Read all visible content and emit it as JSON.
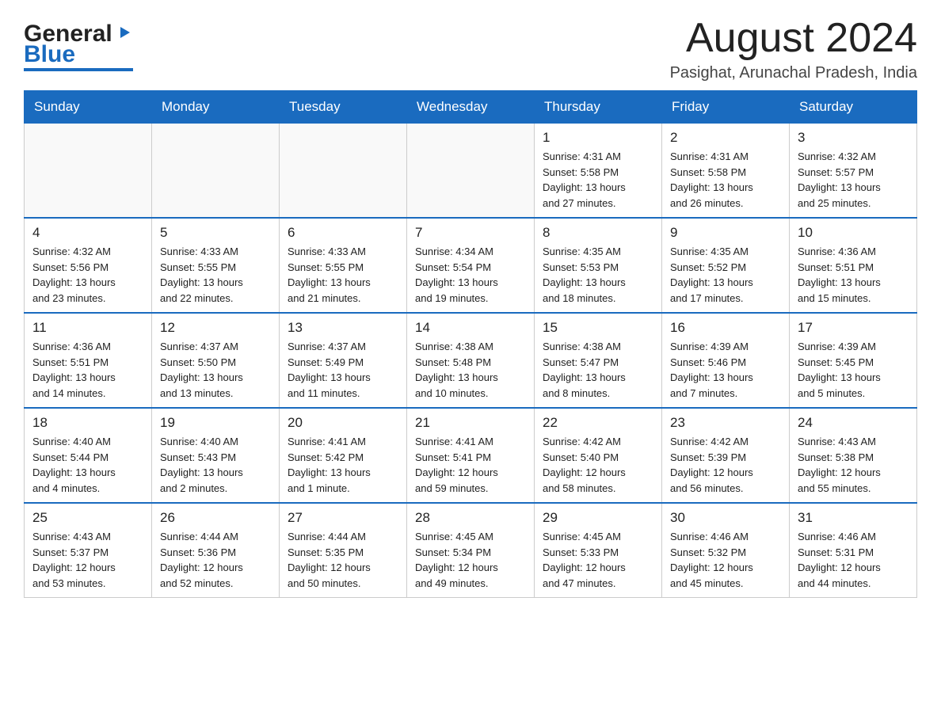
{
  "header": {
    "logo_general": "General",
    "logo_blue": "Blue",
    "main_title": "August 2024",
    "subtitle": "Pasighat, Arunachal Pradesh, India"
  },
  "days_of_week": [
    "Sunday",
    "Monday",
    "Tuesday",
    "Wednesday",
    "Thursday",
    "Friday",
    "Saturday"
  ],
  "weeks": [
    [
      {
        "day": "",
        "info": ""
      },
      {
        "day": "",
        "info": ""
      },
      {
        "day": "",
        "info": ""
      },
      {
        "day": "",
        "info": ""
      },
      {
        "day": "1",
        "info": "Sunrise: 4:31 AM\nSunset: 5:58 PM\nDaylight: 13 hours\nand 27 minutes."
      },
      {
        "day": "2",
        "info": "Sunrise: 4:31 AM\nSunset: 5:58 PM\nDaylight: 13 hours\nand 26 minutes."
      },
      {
        "day": "3",
        "info": "Sunrise: 4:32 AM\nSunset: 5:57 PM\nDaylight: 13 hours\nand 25 minutes."
      }
    ],
    [
      {
        "day": "4",
        "info": "Sunrise: 4:32 AM\nSunset: 5:56 PM\nDaylight: 13 hours\nand 23 minutes."
      },
      {
        "day": "5",
        "info": "Sunrise: 4:33 AM\nSunset: 5:55 PM\nDaylight: 13 hours\nand 22 minutes."
      },
      {
        "day": "6",
        "info": "Sunrise: 4:33 AM\nSunset: 5:55 PM\nDaylight: 13 hours\nand 21 minutes."
      },
      {
        "day": "7",
        "info": "Sunrise: 4:34 AM\nSunset: 5:54 PM\nDaylight: 13 hours\nand 19 minutes."
      },
      {
        "day": "8",
        "info": "Sunrise: 4:35 AM\nSunset: 5:53 PM\nDaylight: 13 hours\nand 18 minutes."
      },
      {
        "day": "9",
        "info": "Sunrise: 4:35 AM\nSunset: 5:52 PM\nDaylight: 13 hours\nand 17 minutes."
      },
      {
        "day": "10",
        "info": "Sunrise: 4:36 AM\nSunset: 5:51 PM\nDaylight: 13 hours\nand 15 minutes."
      }
    ],
    [
      {
        "day": "11",
        "info": "Sunrise: 4:36 AM\nSunset: 5:51 PM\nDaylight: 13 hours\nand 14 minutes."
      },
      {
        "day": "12",
        "info": "Sunrise: 4:37 AM\nSunset: 5:50 PM\nDaylight: 13 hours\nand 13 minutes."
      },
      {
        "day": "13",
        "info": "Sunrise: 4:37 AM\nSunset: 5:49 PM\nDaylight: 13 hours\nand 11 minutes."
      },
      {
        "day": "14",
        "info": "Sunrise: 4:38 AM\nSunset: 5:48 PM\nDaylight: 13 hours\nand 10 minutes."
      },
      {
        "day": "15",
        "info": "Sunrise: 4:38 AM\nSunset: 5:47 PM\nDaylight: 13 hours\nand 8 minutes."
      },
      {
        "day": "16",
        "info": "Sunrise: 4:39 AM\nSunset: 5:46 PM\nDaylight: 13 hours\nand 7 minutes."
      },
      {
        "day": "17",
        "info": "Sunrise: 4:39 AM\nSunset: 5:45 PM\nDaylight: 13 hours\nand 5 minutes."
      }
    ],
    [
      {
        "day": "18",
        "info": "Sunrise: 4:40 AM\nSunset: 5:44 PM\nDaylight: 13 hours\nand 4 minutes."
      },
      {
        "day": "19",
        "info": "Sunrise: 4:40 AM\nSunset: 5:43 PM\nDaylight: 13 hours\nand 2 minutes."
      },
      {
        "day": "20",
        "info": "Sunrise: 4:41 AM\nSunset: 5:42 PM\nDaylight: 13 hours\nand 1 minute."
      },
      {
        "day": "21",
        "info": "Sunrise: 4:41 AM\nSunset: 5:41 PM\nDaylight: 12 hours\nand 59 minutes."
      },
      {
        "day": "22",
        "info": "Sunrise: 4:42 AM\nSunset: 5:40 PM\nDaylight: 12 hours\nand 58 minutes."
      },
      {
        "day": "23",
        "info": "Sunrise: 4:42 AM\nSunset: 5:39 PM\nDaylight: 12 hours\nand 56 minutes."
      },
      {
        "day": "24",
        "info": "Sunrise: 4:43 AM\nSunset: 5:38 PM\nDaylight: 12 hours\nand 55 minutes."
      }
    ],
    [
      {
        "day": "25",
        "info": "Sunrise: 4:43 AM\nSunset: 5:37 PM\nDaylight: 12 hours\nand 53 minutes."
      },
      {
        "day": "26",
        "info": "Sunrise: 4:44 AM\nSunset: 5:36 PM\nDaylight: 12 hours\nand 52 minutes."
      },
      {
        "day": "27",
        "info": "Sunrise: 4:44 AM\nSunset: 5:35 PM\nDaylight: 12 hours\nand 50 minutes."
      },
      {
        "day": "28",
        "info": "Sunrise: 4:45 AM\nSunset: 5:34 PM\nDaylight: 12 hours\nand 49 minutes."
      },
      {
        "day": "29",
        "info": "Sunrise: 4:45 AM\nSunset: 5:33 PM\nDaylight: 12 hours\nand 47 minutes."
      },
      {
        "day": "30",
        "info": "Sunrise: 4:46 AM\nSunset: 5:32 PM\nDaylight: 12 hours\nand 45 minutes."
      },
      {
        "day": "31",
        "info": "Sunrise: 4:46 AM\nSunset: 5:31 PM\nDaylight: 12 hours\nand 44 minutes."
      }
    ]
  ]
}
